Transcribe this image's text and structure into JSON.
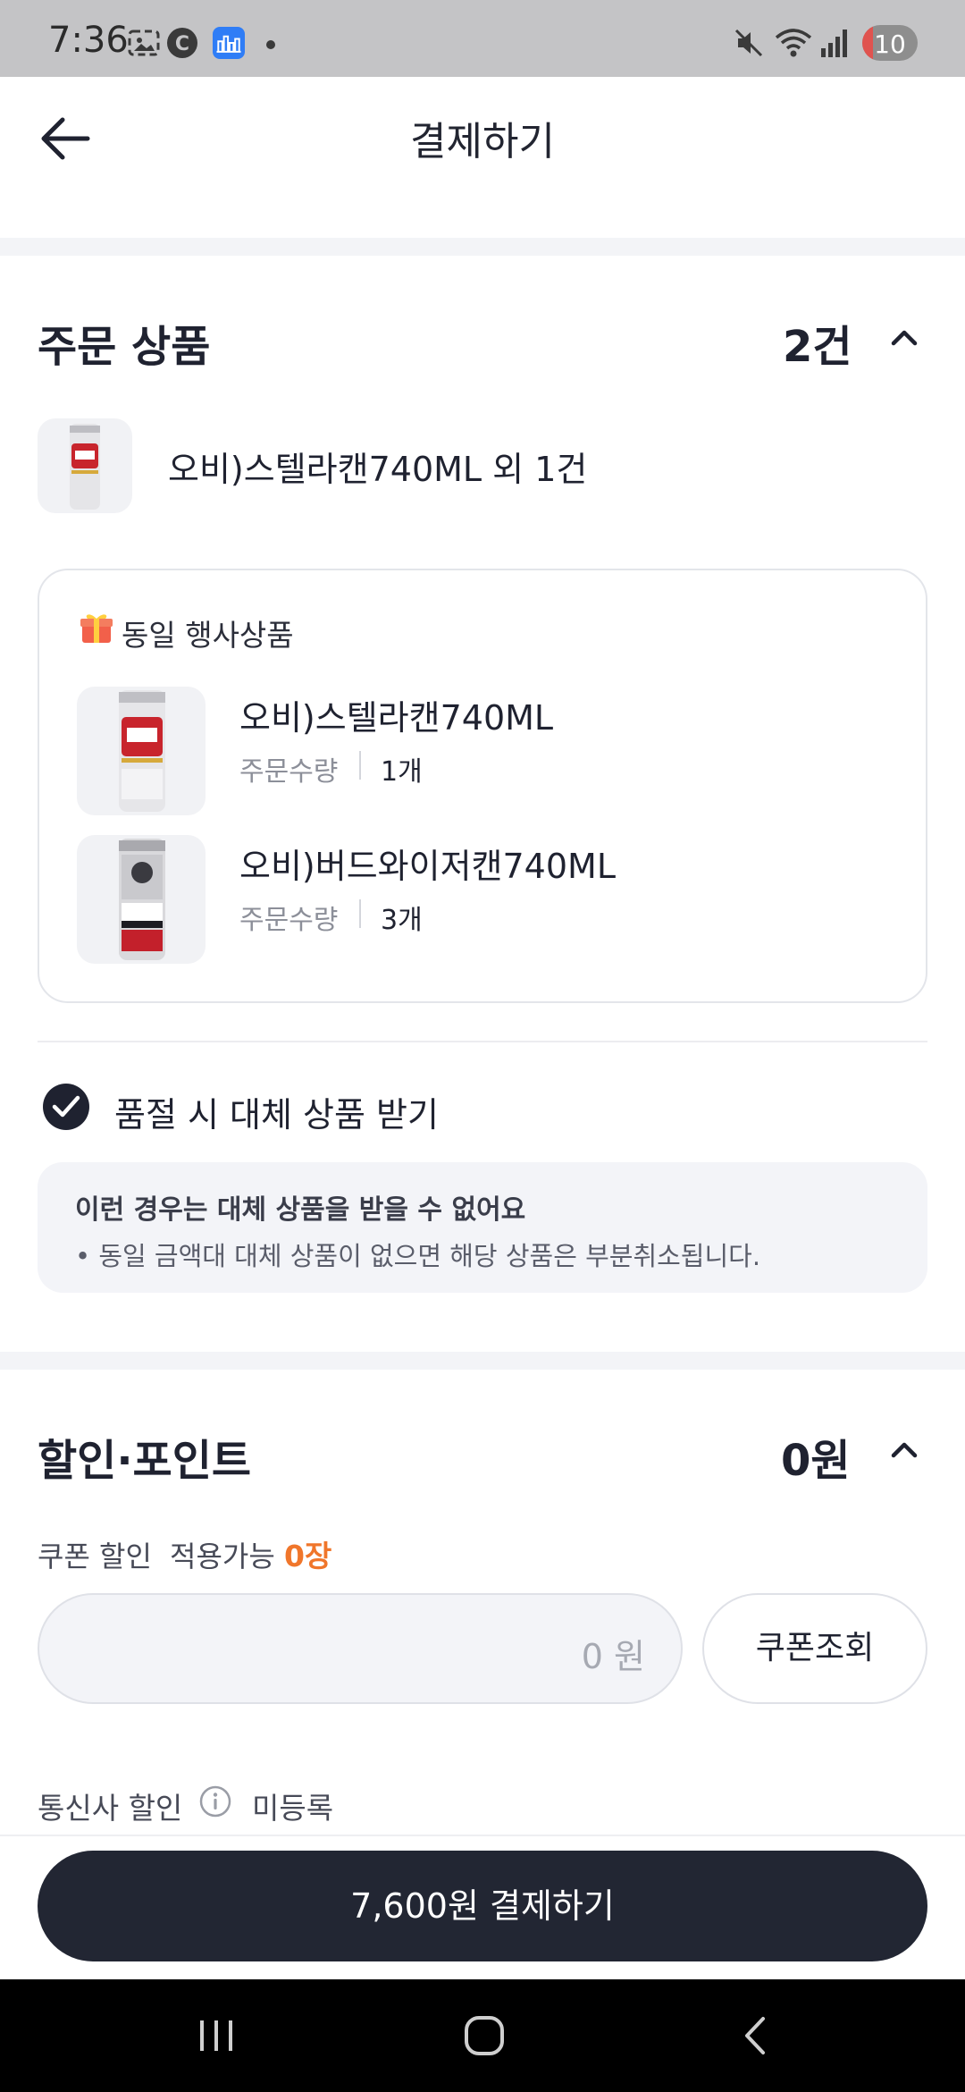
{
  "status_bar": {
    "time": "7:36",
    "battery": "10",
    "icons": [
      "screenshot-icon",
      "c-app-icon",
      "cityscape-app-icon",
      "notification-dot-icon",
      "mute-icon",
      "wifi-icon",
      "signal-icon",
      "battery-icon"
    ]
  },
  "header": {
    "title": "결제하기",
    "back_icon": "arrow-left-icon"
  },
  "order": {
    "title": "주문 상품",
    "count": "2건",
    "summary": "오비)스텔라캔740ML 외 1건",
    "event": {
      "title": "동일 행사상품",
      "items": [
        {
          "name": "오비)스텔라캔740ML",
          "qty_label": "주문수량",
          "qty": "1개"
        },
        {
          "name": "오비)버드와이저캔740ML",
          "qty_label": "주문수량",
          "qty": "3개"
        }
      ]
    },
    "substitute": {
      "label": "품절 시 대체 상품 받기",
      "checked": true
    },
    "notice": {
      "title": "이런 경우는 대체 상품을 받을 수 없어요",
      "body": "• 동일 금액대 대체 상품이 없으면 해당 상품은 부분취소됩니다."
    }
  },
  "discount": {
    "title": "할인·포인트",
    "total": "0원",
    "coupon_label": "쿠폰 할인",
    "coupon_available_label": "적용가능",
    "coupon_count": "0장",
    "coupon_amount": "0 원",
    "coupon_button": "쿠폰조회",
    "telecom_label": "통신사 할인",
    "telecom_status": "미등록"
  },
  "pay_button": "7,600원 결제하기",
  "colors": {
    "primary_dark": "#222633",
    "accent_orange": "#f0762b",
    "band_gray": "#f3f4f7"
  }
}
